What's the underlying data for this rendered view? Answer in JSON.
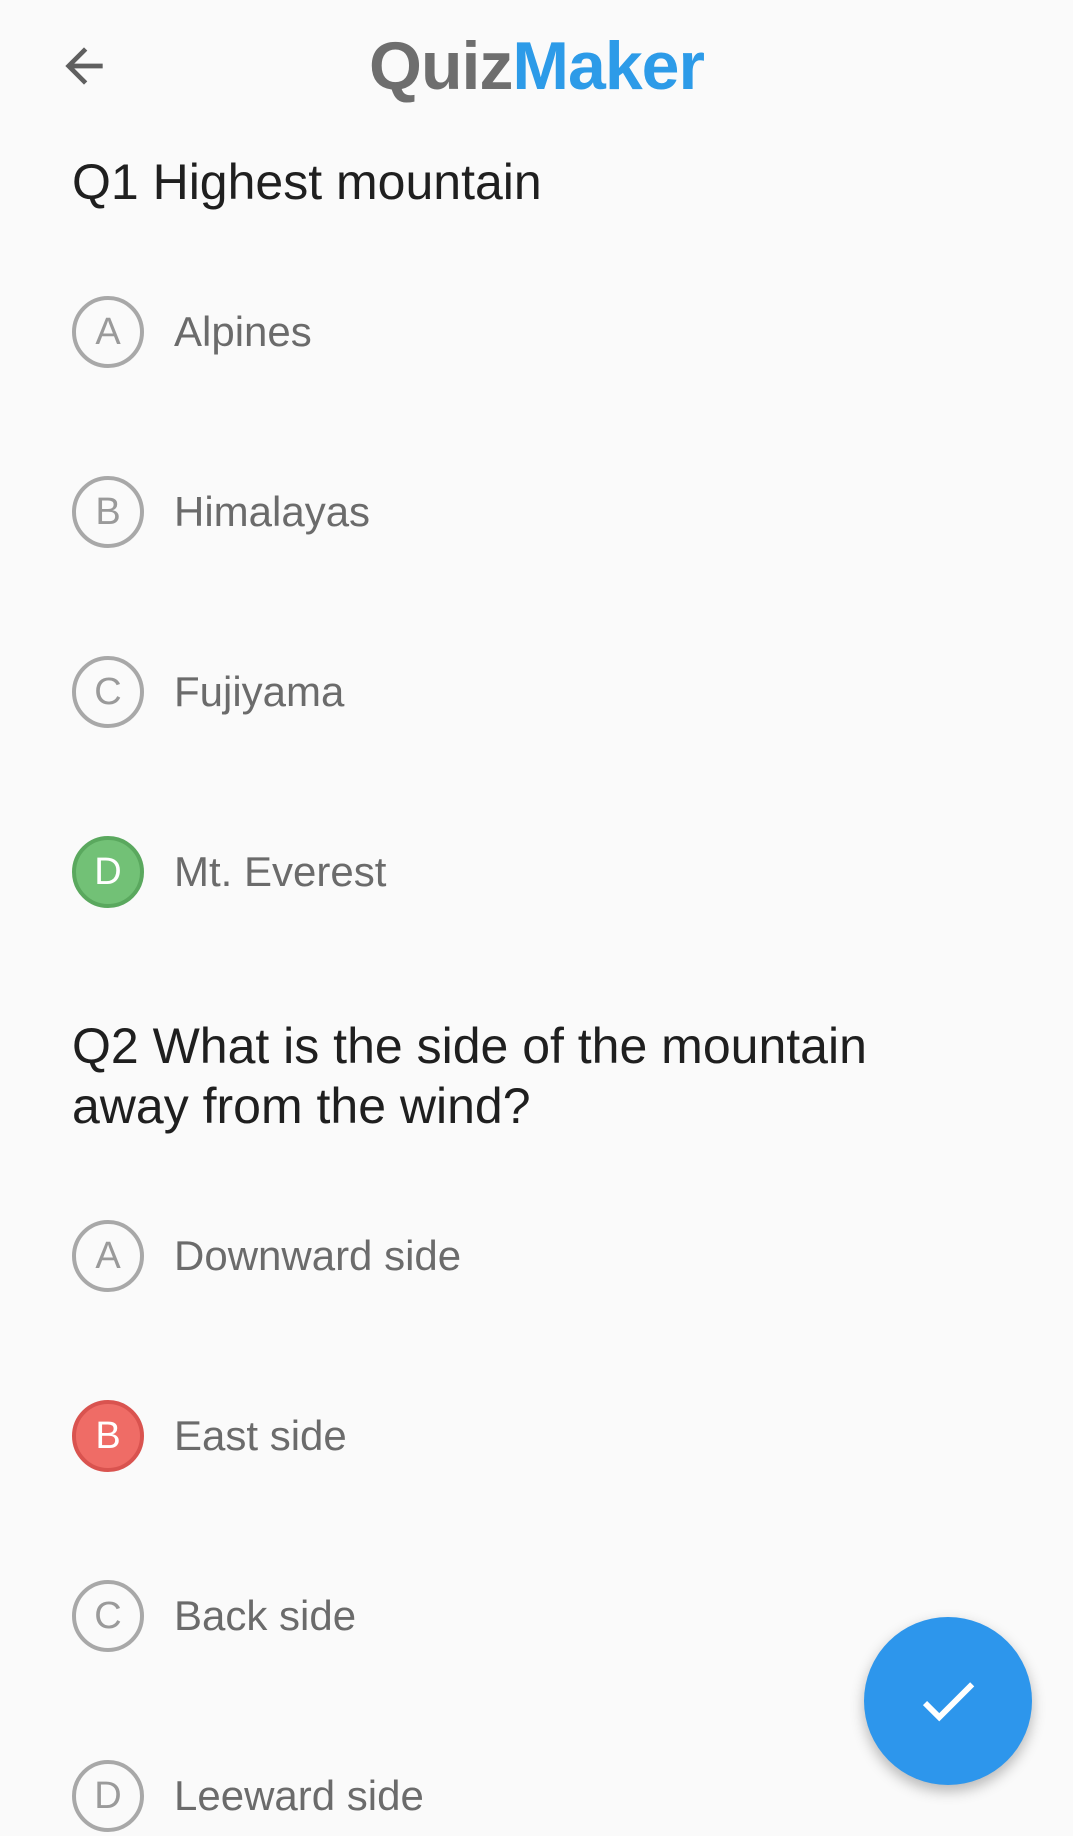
{
  "app_bar": {
    "title_part1": "Quiz",
    "title_part2": "Maker",
    "back_icon": "arrow-left-icon"
  },
  "questions": [
    {
      "title": "Q1 Highest mountain",
      "options": [
        {
          "letter": "A",
          "label": "Alpines",
          "state": "unselected"
        },
        {
          "letter": "B",
          "label": "Himalayas",
          "state": "unselected"
        },
        {
          "letter": "C",
          "label": "Fujiyama",
          "state": "unselected"
        },
        {
          "letter": "D",
          "label": "Mt. Everest",
          "state": "correct"
        }
      ]
    },
    {
      "title": "Q2 What is the side of the mountain away from the wind?",
      "options": [
        {
          "letter": "A",
          "label": "Downward side",
          "state": "unselected"
        },
        {
          "letter": "B",
          "label": "East side",
          "state": "wrong"
        },
        {
          "letter": "C",
          "label": "Back side",
          "state": "unselected"
        },
        {
          "letter": "D",
          "label": "Leeward side",
          "state": "unselected"
        }
      ]
    }
  ],
  "fab": {
    "icon": "check-icon"
  },
  "colors": {
    "accent": "#2d96ec",
    "correct": "#72c176",
    "wrong": "#ef6c66",
    "title_gray": "#6e6e6e"
  }
}
